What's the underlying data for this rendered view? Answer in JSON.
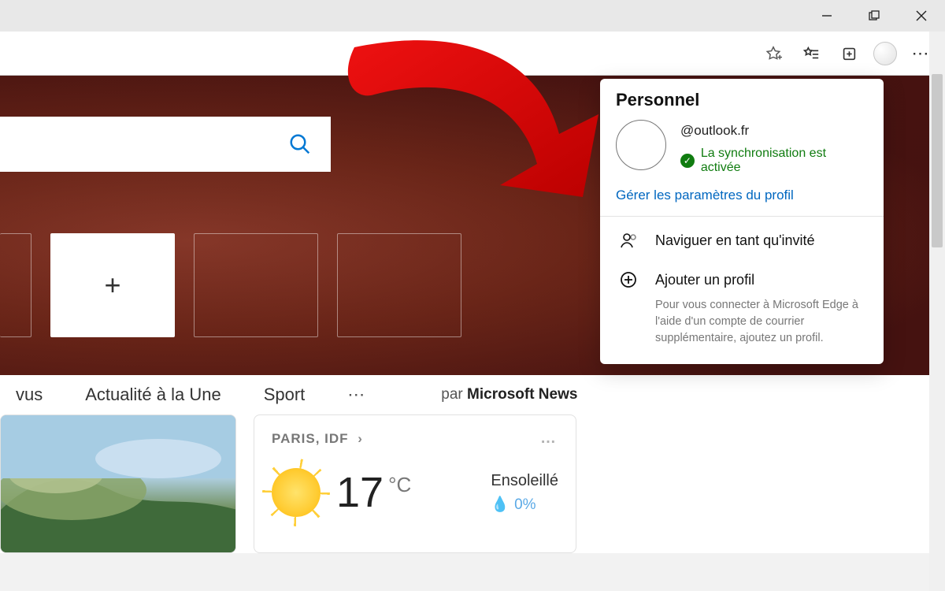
{
  "window": {
    "minimize": "—",
    "maximize": "❐",
    "close": "✕"
  },
  "toolbar": {
    "fav_add": "star-add",
    "favorites": "favorites",
    "collections": "collections",
    "profile": "profile",
    "more": "⋯"
  },
  "profile_flyout": {
    "title": "Personnel",
    "email": "@outlook.fr",
    "sync_status": "La synchronisation est activée",
    "manage_link": "Gérer les paramètres du profil",
    "guest": "Naviguer en tant qu'invité",
    "add_profile": "Ajouter un profil",
    "add_profile_desc": "Pour vous connecter à Microsoft Edge à l'aide d'un compte de courrier supplémentaire, ajoutez un profil."
  },
  "news_tabs": {
    "vus": "vus",
    "une": "Actualité à la Une",
    "sport": "Sport",
    "more": "⋯",
    "by_prefix": "par ",
    "by_source": "Microsoft News"
  },
  "weather": {
    "location": "PARIS, IDF",
    "temp": "17",
    "unit": "°C",
    "condition": "Ensoleillé",
    "precip": "0%"
  }
}
